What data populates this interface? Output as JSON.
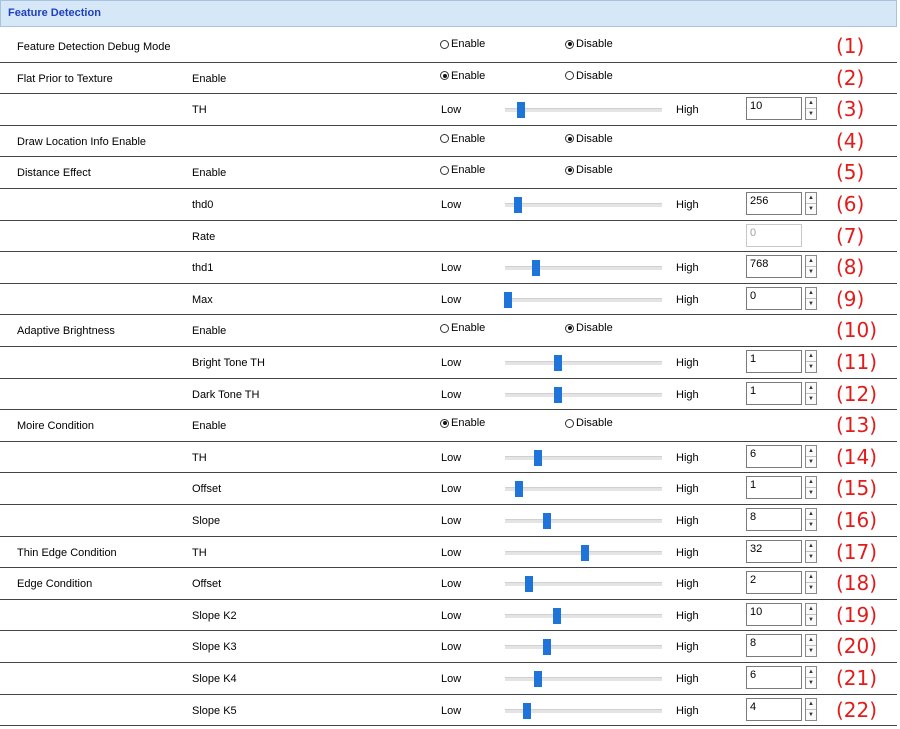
{
  "header": {
    "title": "Feature Detection"
  },
  "rows": [
    {
      "group": "Feature Detection Debug Mode",
      "sub": "",
      "kind": "radio",
      "enable_label": "Enable",
      "disable_label": "Disable",
      "selected": "disable",
      "num": "(1)"
    },
    {
      "group": "Flat Prior to Texture",
      "sub": "Enable",
      "kind": "radio",
      "enable_label": "Enable",
      "disable_label": "Disable",
      "selected": "enable",
      "num": "(2)"
    },
    {
      "group": "",
      "sub": "TH",
      "kind": "slider",
      "low": "Low",
      "high": "High",
      "value": "10",
      "level": 0.1,
      "num": "(3)"
    },
    {
      "group": "Draw Location Info Enable",
      "sub": "",
      "kind": "radio",
      "enable_label": "Enable",
      "disable_label": "Disable",
      "selected": "disable",
      "num": "(4)"
    },
    {
      "group": "Distance Effect",
      "sub": "Enable",
      "kind": "radio",
      "enable_label": "Enable",
      "disable_label": "Disable",
      "selected": "disable",
      "num": "(5)"
    },
    {
      "group": "",
      "sub": "thd0",
      "kind": "slider",
      "low": "Low",
      "high": "High",
      "value": "256",
      "level": 0.08,
      "num": "(6)"
    },
    {
      "group": "",
      "sub": "Rate",
      "kind": "disabled",
      "value": "0",
      "num": "(7)"
    },
    {
      "group": "",
      "sub": "thd1",
      "kind": "slider",
      "low": "Low",
      "high": "High",
      "value": "768",
      "level": 0.2,
      "num": "(8)"
    },
    {
      "group": "",
      "sub": "Max",
      "kind": "slider",
      "low": "Low",
      "high": "High",
      "value": "0",
      "level": 0.02,
      "num": "(9)"
    },
    {
      "group": "Adaptive Brightness",
      "sub": "Enable",
      "kind": "radio",
      "enable_label": "Enable",
      "disable_label": "Disable",
      "selected": "disable",
      "num": "(10)"
    },
    {
      "group": "",
      "sub": "Bright Tone TH",
      "kind": "slider",
      "low": "Low",
      "high": "High",
      "value": "1",
      "level": 0.34,
      "num": "(11)"
    },
    {
      "group": "",
      "sub": "Dark Tone TH",
      "kind": "slider",
      "low": "Low",
      "high": "High",
      "value": "1",
      "level": 0.34,
      "num": "(12)"
    },
    {
      "group": "Moire Condition",
      "sub": "Enable",
      "kind": "radio",
      "enable_label": "Enable",
      "disable_label": "Disable",
      "selected": "enable",
      "num": "(13)"
    },
    {
      "group": "",
      "sub": "TH",
      "kind": "slider",
      "low": "Low",
      "high": "High",
      "value": "6",
      "level": 0.21,
      "num": "(14)"
    },
    {
      "group": "",
      "sub": "Offset",
      "kind": "slider",
      "low": "Low",
      "high": "High",
      "value": "1",
      "level": 0.09,
      "num": "(15)"
    },
    {
      "group": "",
      "sub": "Slope",
      "kind": "slider",
      "low": "Low",
      "high": "High",
      "value": "8",
      "level": 0.27,
      "num": "(16)"
    },
    {
      "group": "Thin Edge Condition",
      "sub": "TH",
      "kind": "slider",
      "low": "Low",
      "high": "High",
      "value": "32",
      "level": 0.51,
      "num": "(17)"
    },
    {
      "group": "Edge Condition",
      "sub": "Offset",
      "kind": "slider",
      "low": "Low",
      "high": "High",
      "value": "2",
      "level": 0.15,
      "num": "(18)"
    },
    {
      "group": "",
      "sub": "Slope K2",
      "kind": "slider",
      "low": "Low",
      "high": "High",
      "value": "10",
      "level": 0.33,
      "num": "(19)"
    },
    {
      "group": "",
      "sub": "Slope K3",
      "kind": "slider",
      "low": "Low",
      "high": "High",
      "value": "8",
      "level": 0.27,
      "num": "(20)"
    },
    {
      "group": "",
      "sub": "Slope K4",
      "kind": "slider",
      "low": "Low",
      "high": "High",
      "value": "6",
      "level": 0.21,
      "num": "(21)"
    },
    {
      "group": "",
      "sub": "Slope K5",
      "kind": "slider",
      "low": "Low",
      "high": "High",
      "value": "4",
      "level": 0.14,
      "num": "(22)"
    }
  ]
}
